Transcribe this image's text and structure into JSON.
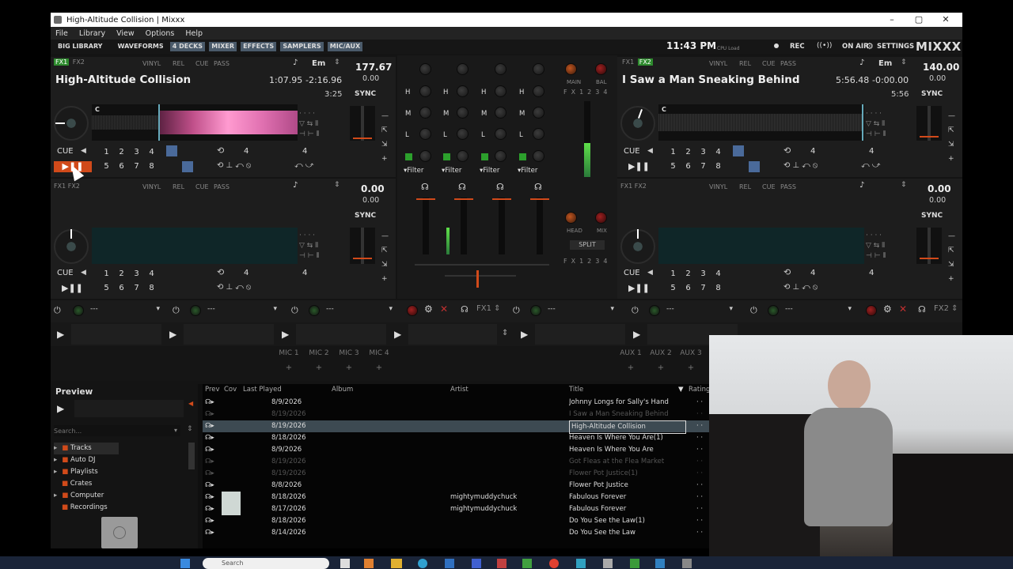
{
  "window": {
    "title": "High-Altitude Collision | Mixxx",
    "controls": [
      "–",
      "▢",
      "✕"
    ]
  },
  "menu": [
    "File",
    "Library",
    "View",
    "Options",
    "Help"
  ],
  "toolbar": {
    "left": [
      "BIG LIBRARY",
      "WAVEFORMS",
      "4 DECKS",
      "MIXER",
      "EFFECTS",
      "SAMPLERS",
      "MIC/AUX"
    ],
    "clock": "11:43 PM",
    "cpu_label": "CPU Load",
    "rec": "REC",
    "on_air": "ON AIR",
    "settings": "SETTINGS",
    "logo": "MIXXX"
  },
  "decks": [
    {
      "fx1": "FX1",
      "fx2": "FX2",
      "vinyl": "VINYL",
      "rel": "REL",
      "cue_mode": "CUE",
      "pass": "PASS",
      "key": "Em",
      "bpm": "177.67",
      "rate": "0.00",
      "title": "High-Altitude Collision",
      "elapsed": "1:07.95",
      "remaining": "-2:16.96",
      "duration": "3:25",
      "sync": "SYNC",
      "cue": "CUE",
      "hotcues_top": [
        "1",
        "2",
        "3",
        "4"
      ],
      "hotcues_bottom": [
        "5",
        "6",
        "7",
        "8"
      ],
      "loop_size": "4",
      "beatjump": "4",
      "cue_marker": "C"
    },
    {
      "fx1": "FX1",
      "fx2": "FX2",
      "vinyl": "VINYL",
      "rel": "REL",
      "cue_mode": "CUE",
      "pass": "PASS",
      "key": "Em",
      "bpm": "140.00",
      "rate": "0.00",
      "title": "I Saw a Man Sneaking Behind",
      "elapsed": "5:56.48",
      "remaining": "-0:00.00",
      "duration": "5:56",
      "sync": "SYNC",
      "cue": "CUE",
      "hotcues_top": [
        "1",
        "2",
        "3",
        "4"
      ],
      "hotcues_bottom": [
        "5",
        "6",
        "7",
        "8"
      ],
      "loop_size": "4",
      "beatjump": "4",
      "cue_marker": "C"
    },
    {
      "fx1": "FX1",
      "fx2": "FX2",
      "vinyl": "VINYL",
      "rel": "REL",
      "cue_mode": "CUE",
      "pass": "PASS",
      "bpm": "0.00",
      "rate": "0.00",
      "sync": "SYNC",
      "cue": "CUE",
      "hotcues_top": [
        "1",
        "2",
        "3",
        "4"
      ],
      "hotcues_bottom": [
        "5",
        "6",
        "7",
        "8"
      ],
      "loop_size": "4",
      "beatjump": "4"
    },
    {
      "fx1": "FX1",
      "fx2": "FX2",
      "vinyl": "VINYL",
      "rel": "REL",
      "cue_mode": "CUE",
      "pass": "PASS",
      "bpm": "0.00",
      "rate": "0.00",
      "sync": "SYNC",
      "cue": "CUE",
      "hotcues_top": [
        "1",
        "2",
        "3",
        "4"
      ],
      "hotcues_bottom": [
        "5",
        "6",
        "7",
        "8"
      ],
      "loop_size": "4",
      "beatjump": "4"
    }
  ],
  "mixer": {
    "main": "MAIN",
    "bal": "BAL",
    "head": "HEAD",
    "mix": "MIX",
    "split": "SPLIT",
    "fx_assign": [
      "FX1",
      "2",
      "3",
      "4"
    ],
    "eq_labels": [
      "H",
      "M",
      "L"
    ],
    "filter": "Filter",
    "main_vu_level": 0.45,
    "deck2_vu_level": 0.35
  },
  "fx_units": [
    {
      "name": "---"
    },
    {
      "name": "---"
    },
    {
      "name": "---"
    },
    {
      "name": "---"
    },
    {
      "name": "---"
    },
    {
      "name": "---"
    }
  ],
  "fx_unit_labels": [
    "FX1",
    "FX2"
  ],
  "mics": [
    "MIC 1",
    "MIC 2",
    "MIC 3",
    "MIC 4"
  ],
  "auxes": [
    "AUX 1",
    "AUX 2",
    "AUX 3"
  ],
  "library": {
    "preview_label": "Preview",
    "search_placeholder": "Search...",
    "tree": [
      "Tracks",
      "Auto DJ",
      "Playlists",
      "Crates",
      "Computer",
      "Recordings"
    ],
    "columns": [
      "Prev",
      "Cov",
      "Last Played",
      "Album",
      "Artist",
      "Title",
      "Rating"
    ],
    "rows": [
      {
        "last_played": "8/9/2026",
        "artist": "",
        "title": "Johnny Longs for Sally's Hand"
      },
      {
        "last_played": "8/19/2026",
        "artist": "",
        "title": "I Saw a Man Sneaking Behind",
        "dim": true
      },
      {
        "last_played": "8/19/2026",
        "artist": "",
        "title": "High-Altitude Collision",
        "selected": true
      },
      {
        "last_played": "8/18/2026",
        "artist": "",
        "title": "Heaven Is Where You Are(1)"
      },
      {
        "last_played": "8/9/2026",
        "artist": "",
        "title": "Heaven Is Where You Are"
      },
      {
        "last_played": "8/19/2026",
        "artist": "",
        "title": "Got Fleas at the Flea Market",
        "dim": true
      },
      {
        "last_played": "8/19/2026",
        "artist": "",
        "title": "Flower Pot Justice(1)",
        "dim": true
      },
      {
        "last_played": "8/8/2026",
        "artist": "",
        "title": "Flower Pot Justice"
      },
      {
        "last_played": "8/18/2026",
        "artist": "mightymuddychuck",
        "title": "Fabulous Forever"
      },
      {
        "last_played": "8/17/2026",
        "artist": "mightymuddychuck",
        "title": "Fabulous Forever"
      },
      {
        "last_played": "8/18/2026",
        "artist": "",
        "title": "Do You See the Law(1)"
      },
      {
        "last_played": "8/14/2026",
        "artist": "",
        "title": "Do You See the Law"
      }
    ]
  },
  "taskbar": {
    "search_placeholder": "Search"
  }
}
